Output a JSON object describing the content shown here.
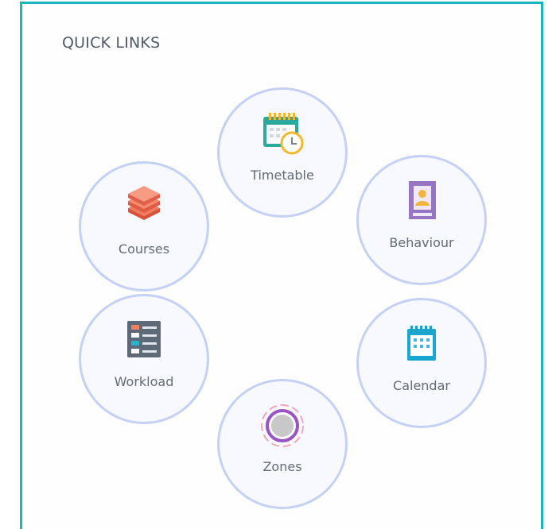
{
  "panel": {
    "title": "QUICK LINKS"
  },
  "links": [
    {
      "label": "Timetable",
      "icon": "timetable-icon",
      "color": "#26b3a8"
    },
    {
      "label": "Courses",
      "icon": "courses-stack-icon",
      "color": "#f26b4f"
    },
    {
      "label": "Behaviour",
      "icon": "behaviour-profile-icon",
      "color": "#9b78c8"
    },
    {
      "label": "Workload",
      "icon": "workload-list-icon",
      "color": "#5e6b78"
    },
    {
      "label": "Calendar",
      "icon": "calendar-icon",
      "color": "#2aa7cf"
    },
    {
      "label": "Zones",
      "icon": "zones-target-icon",
      "color": "#c18ee3"
    }
  ],
  "colors": {
    "panel_border": "#17b7bd",
    "circle_border": "#c5d0f5"
  }
}
